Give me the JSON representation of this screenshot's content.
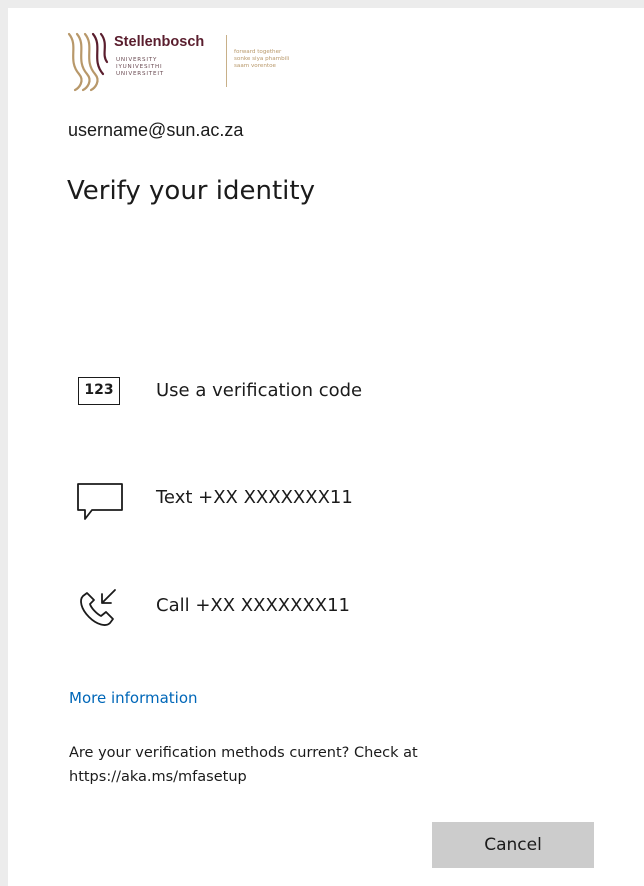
{
  "logo": {
    "name": "Stellenbosch",
    "sub_lines": [
      "UNIVERSITY",
      "IYUNIVESITHI",
      "UNIVERSITEIT"
    ],
    "tagline_lines": [
      "forward together",
      "sonke siya phambili",
      "saam vorentoe"
    ],
    "colors": {
      "maroon": "#5a1e2e",
      "gold": "#b8986a"
    }
  },
  "username": "username@sun.ac.za",
  "title": "Verify your identity",
  "options": [
    {
      "icon": "verification-code-icon",
      "badge": "123",
      "label": "Use a verification code"
    },
    {
      "icon": "message-icon",
      "label": "Text +XX XXXXXXX11"
    },
    {
      "icon": "incoming-call-icon",
      "label": "Call +XX XXXXXXX11"
    }
  ],
  "more_info_label": "More information",
  "note": "Are your verification methods current? Check at https://aka.ms/mfasetup",
  "cancel_label": "Cancel",
  "colors": {
    "link": "#0067b8",
    "button_bg": "#cccccc",
    "text": "#1b1b1b"
  }
}
